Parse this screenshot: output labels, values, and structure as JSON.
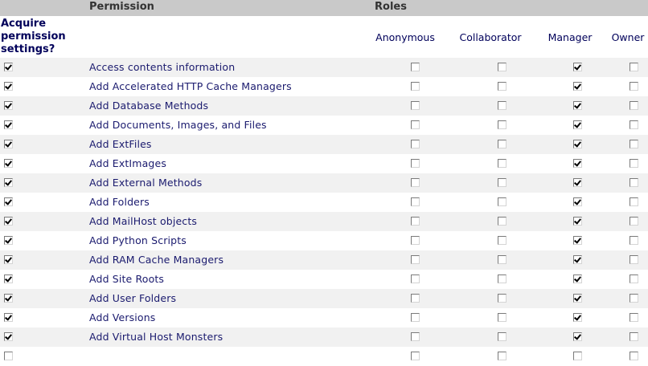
{
  "header": {
    "permission": "Permission",
    "roles": "Roles"
  },
  "acquire_heading": "Acquire permission settings?",
  "roles": [
    "Anonymous",
    "Collaborator",
    "Manager",
    "Owner"
  ],
  "rows": [
    {
      "permission": "Access contents information",
      "acquire": true,
      "roles": [
        false,
        false,
        true,
        false
      ]
    },
    {
      "permission": "Add Accelerated HTTP Cache Managers",
      "acquire": true,
      "roles": [
        false,
        false,
        true,
        false
      ]
    },
    {
      "permission": "Add Database Methods",
      "acquire": true,
      "roles": [
        false,
        false,
        true,
        false
      ]
    },
    {
      "permission": "Add Documents, Images, and Files",
      "acquire": true,
      "roles": [
        false,
        false,
        true,
        false
      ]
    },
    {
      "permission": "Add ExtFiles",
      "acquire": true,
      "roles": [
        false,
        false,
        true,
        false
      ]
    },
    {
      "permission": "Add ExtImages",
      "acquire": true,
      "roles": [
        false,
        false,
        true,
        false
      ]
    },
    {
      "permission": "Add External Methods",
      "acquire": true,
      "roles": [
        false,
        false,
        true,
        false
      ]
    },
    {
      "permission": "Add Folders",
      "acquire": true,
      "roles": [
        false,
        false,
        true,
        false
      ]
    },
    {
      "permission": "Add MailHost objects",
      "acquire": true,
      "roles": [
        false,
        false,
        true,
        false
      ]
    },
    {
      "permission": "Add Python Scripts",
      "acquire": true,
      "roles": [
        false,
        false,
        true,
        false
      ]
    },
    {
      "permission": "Add RAM Cache Managers",
      "acquire": true,
      "roles": [
        false,
        false,
        true,
        false
      ]
    },
    {
      "permission": "Add Site Roots",
      "acquire": true,
      "roles": [
        false,
        false,
        true,
        false
      ]
    },
    {
      "permission": "Add User Folders",
      "acquire": true,
      "roles": [
        false,
        false,
        true,
        false
      ]
    },
    {
      "permission": "Add Versions",
      "acquire": true,
      "roles": [
        false,
        false,
        true,
        false
      ]
    },
    {
      "permission": "Add Virtual Host Monsters",
      "acquire": true,
      "roles": [
        false,
        false,
        true,
        false
      ]
    },
    {
      "permission": "",
      "acquire": false,
      "roles": [
        false,
        false,
        false,
        false
      ]
    }
  ]
}
